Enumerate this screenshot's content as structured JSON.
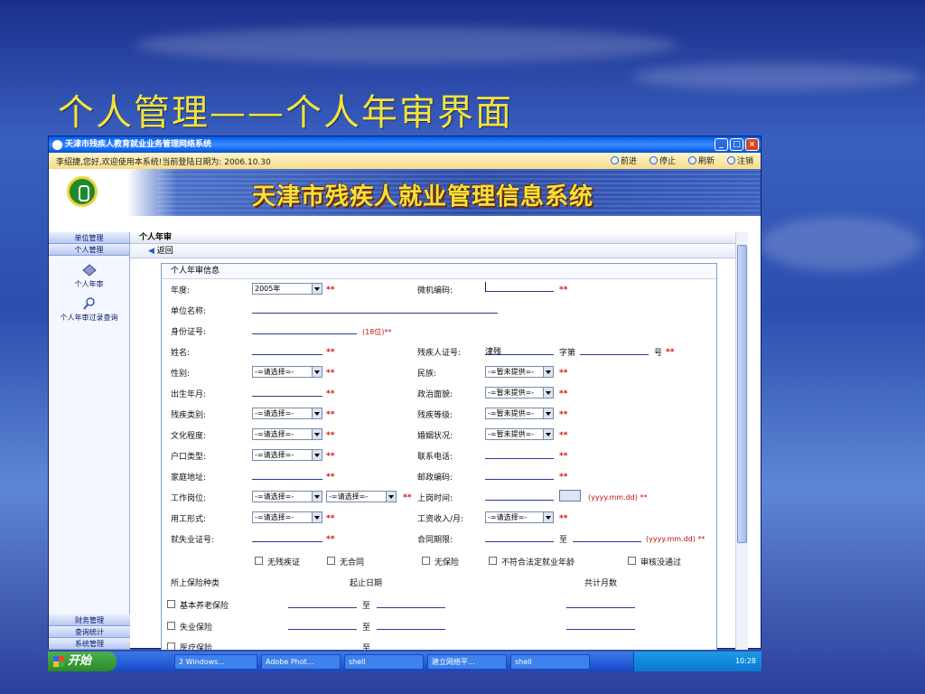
{
  "slide": {
    "title": "个人管理——个人年审界面"
  },
  "window": {
    "title": "天津市残疾人教育就业业务管理网络系统",
    "controls": [
      "_",
      "□",
      "×"
    ]
  },
  "infobar": {
    "greeting": "李绍捷,您好,欢迎使用本系统!当前登陆日期为: 2006.10.30",
    "nav": {
      "forward": "前进",
      "stop": "停止",
      "refresh": "刷新",
      "logout": "注销"
    }
  },
  "banner": {
    "system_title": "天津市残疾人就业管理信息系统"
  },
  "sidebar": {
    "top_tabs": [
      "单位管理",
      "个人管理"
    ],
    "items": [
      "个人年审",
      "个人年审过录查询"
    ],
    "bottom_tabs": [
      "财务管理",
      "查询统计",
      "系统管理"
    ]
  },
  "main": {
    "header": "个人年审",
    "back": "返回",
    "form_title": "个人年审信息"
  },
  "form": {
    "year_label": "年度:",
    "year_value": "2005年",
    "machine_code_label": "微机编码:",
    "unit_name_label": "单位名称:",
    "id_label": "身份证号:",
    "id_hint": "(18位)**",
    "name_label": "姓名:",
    "disability_cert_label": "残疾人证号:",
    "cert_prefix": "津残",
    "cert_word": "字第",
    "cert_number": "号",
    "gender_label": "性别:",
    "gender_value": "-=请选择=-",
    "ethnicity_label": "民族:",
    "ethnicity_value": "-=暂未提供=-",
    "birth_label": "出生年月:",
    "politics_label": "政治面貌:",
    "politics_value": "-=暂未提供=-",
    "disability_type_label": "残疾类别:",
    "disability_type_value": "-=请选择=-",
    "disability_level_label": "残疾等级:",
    "disability_level_value": "-=暂未提供=-",
    "education_label": "文化程度:",
    "education_value": "-=请选择=-",
    "marital_label": "婚姻状况:",
    "marital_value": "-=暂未提供=-",
    "hukou_label": "户口类型:",
    "hukou_value": "-=请选择=-",
    "phone_label": "联系电话:",
    "address_label": "家庭地址:",
    "postcode_label": "邮政编码:",
    "position_label": "工作岗位:",
    "position_value1": "-=请选择=-",
    "position_value2": "-=请选择=-",
    "start_time_label": "上岗时间:",
    "date_hint": "(yyyy.mm.dd) **",
    "employment_form_label": "用工形式:",
    "employment_form_value": "-=请选择=-",
    "salary_label": "工资收入/月:",
    "salary_value": "-=请选择=-",
    "unemployment_cert_label": "就失业证号:",
    "contract_label": "合同期限:",
    "contract_to": "至",
    "contract_hint": "(yyyy.mm.dd) **",
    "checks": [
      "无残疾证",
      "无合同",
      "无保险",
      "不符合法定就业年龄",
      "审核没通过"
    ],
    "insurance_header": "所上保险种类",
    "period_header": "起止日期",
    "months_header": "共计月数",
    "insurances": [
      "基本养老保险",
      "失业保险",
      "医疗保险"
    ],
    "to": "至",
    "required": "**"
  },
  "taskbar": {
    "start": "开始",
    "tasks": [
      "2 Windows...",
      "Adobe Phot...",
      "shell",
      "建立网络平...",
      "shell"
    ],
    "time": "10:28"
  }
}
